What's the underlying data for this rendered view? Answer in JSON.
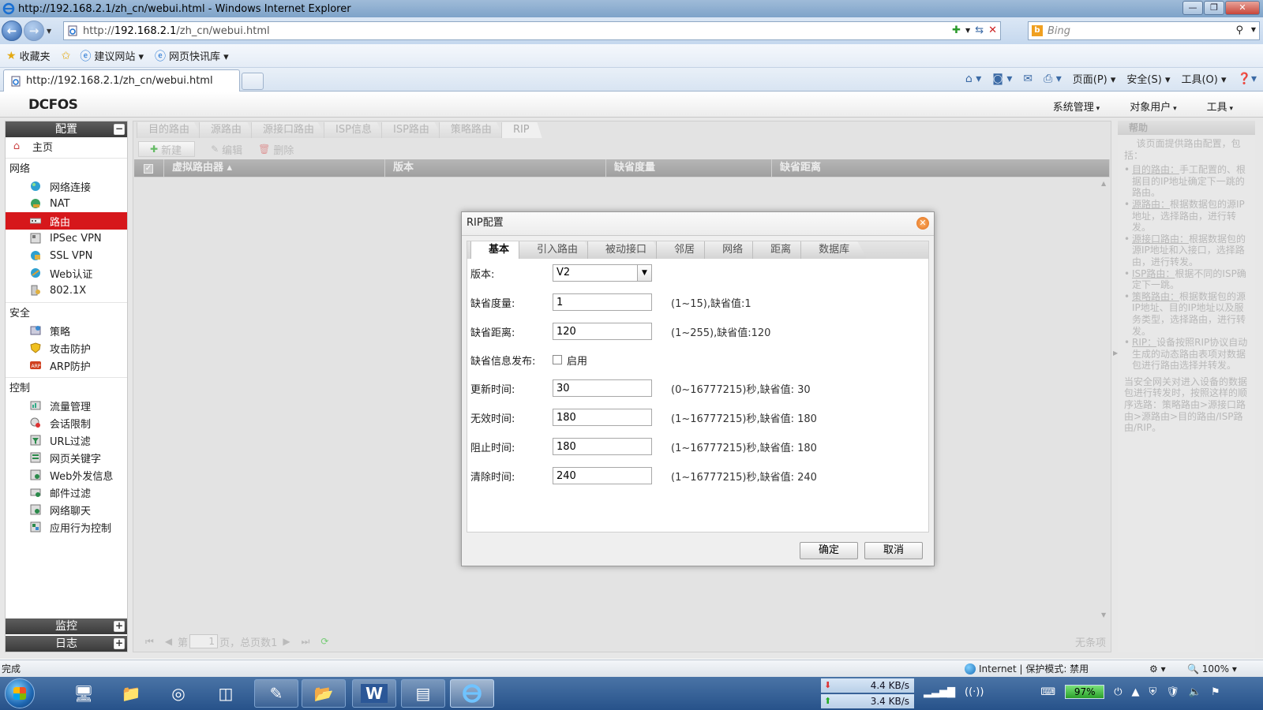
{
  "window": {
    "title": "http://192.168.2.1/zh_cn/webui.html - Windows Internet Explorer",
    "controls": [
      "—",
      "❐",
      "✕"
    ]
  },
  "address": {
    "prefix": "http://",
    "host": "192.168.2.1",
    "path": "/zh_cn/webui.html"
  },
  "search": {
    "placeholder": "Bing"
  },
  "favorites": {
    "favorites_label": "收藏夹",
    "suggested_sites": "建议网站 ▾",
    "web_slice": "网页快讯库 ▾"
  },
  "tab": {
    "label": "http://192.168.2.1/zh_cn/webui.html"
  },
  "commandbar": {
    "page": "页面(P) ▾",
    "safety": "安全(S) ▾",
    "tools": "工具(O) ▾"
  },
  "app": {
    "logo": "DCFOS",
    "topmenu": {
      "system": "系统管理",
      "objects": "对象用户",
      "tools": "工具"
    }
  },
  "sidebar": {
    "header": "配置",
    "home": "主页",
    "groups": {
      "network": {
        "title": "网络",
        "items": [
          "网络连接",
          "NAT",
          "路由",
          "IPSec VPN",
          "SSL VPN",
          "Web认证",
          "802.1X"
        ]
      },
      "security": {
        "title": "安全",
        "items": [
          "策略",
          "攻击防护",
          "ARP防护"
        ]
      },
      "control": {
        "title": "控制",
        "items": [
          "流量管理",
          "会话限制",
          "URL过滤",
          "网页关键字",
          "Web外发信息",
          "邮件过滤",
          "网络聊天",
          "应用行为控制"
        ]
      }
    },
    "monitor": "监控",
    "log": "日志",
    "active_item": "路由"
  },
  "route_tabs": [
    "目的路由",
    "源路由",
    "源接口路由",
    "ISP信息",
    "ISP路由",
    "策略路由",
    "RIP"
  ],
  "toolbar": {
    "new": "新建",
    "edit": "编辑",
    "delete": "删除"
  },
  "grid": {
    "columns": [
      "虚拟路由器 ▴",
      "版本",
      "缺省度量",
      "缺省距离"
    ]
  },
  "pager": {
    "page_prefix": "第",
    "page_value": "1",
    "page_suffix": "页，总页数1",
    "empty": "无条项"
  },
  "help": {
    "title": "帮助",
    "intro": "该页面提供路由配置，包括：",
    "items": [
      {
        "link": "目的路由：",
        "text": "手工配置的、根据目的IP地址确定下一跳的路由。"
      },
      {
        "link": "源路由：",
        "text": "根据数据包的源IP地址，选择路由，进行转发。"
      },
      {
        "link": "源接口路由：",
        "text": "根据数据包的源IP地址和入接口，选择路由，进行转发。"
      },
      {
        "link": "ISP路由：",
        "text": "根据不同的ISP确定下一跳。"
      },
      {
        "link": "策略路由：",
        "text": "根据数据包的源IP地址、目的IP地址以及服务类型，选择路由，进行转发。"
      },
      {
        "link": "RIP：",
        "text": "设备按照RIP协议自动生成的动态路由表项对数据包进行路由选择并转发。"
      }
    ],
    "outro": "当安全网关对进入设备的数据包进行转发时，按照这样的顺序选路：策略路由>源接口路由>源路由>目的路由/ISP路由/RIP。"
  },
  "modal": {
    "title": "RIP配置",
    "tabs": [
      "基本",
      "引入路由",
      "被动接口",
      "邻居",
      "网络",
      "距离",
      "数据库"
    ],
    "active_tab": "基本",
    "fields": {
      "version": {
        "label": "版本:",
        "value": "V2"
      },
      "default_metric": {
        "label": "缺省度量:",
        "value": "1",
        "hint": "(1~15),缺省值:1"
      },
      "default_distance": {
        "label": "缺省距离:",
        "value": "120",
        "hint": "(1~255),缺省值:120"
      },
      "default_info": {
        "label": "缺省信息发布:",
        "checkbox_label": "启用"
      },
      "update_time": {
        "label": "更新时间:",
        "value": "30",
        "hint": "(0~16777215)秒,缺省值: 30"
      },
      "invalid_time": {
        "label": "无效时间:",
        "value": "180",
        "hint": "(1~16777215)秒,缺省值: 180"
      },
      "holddown_time": {
        "label": "阻止时间:",
        "value": "180",
        "hint": "(1~16777215)秒,缺省值: 180"
      },
      "flush_time": {
        "label": "清除时间:",
        "value": "240",
        "hint": "(1~16777215)秒,缺省值: 240"
      }
    },
    "ok": "确定",
    "cancel": "取消"
  },
  "status": {
    "left": "完成",
    "zone": "Internet | 保护模式: 禁用",
    "zoom": "🔍 100% ▾"
  },
  "taskbar": {
    "download": "4.4 KB/s",
    "upload": "3.4 KB/s",
    "battery": "97%"
  },
  "colors": {
    "accent_active": "#d6171b",
    "sidebar_header": "#3a3a3a"
  }
}
